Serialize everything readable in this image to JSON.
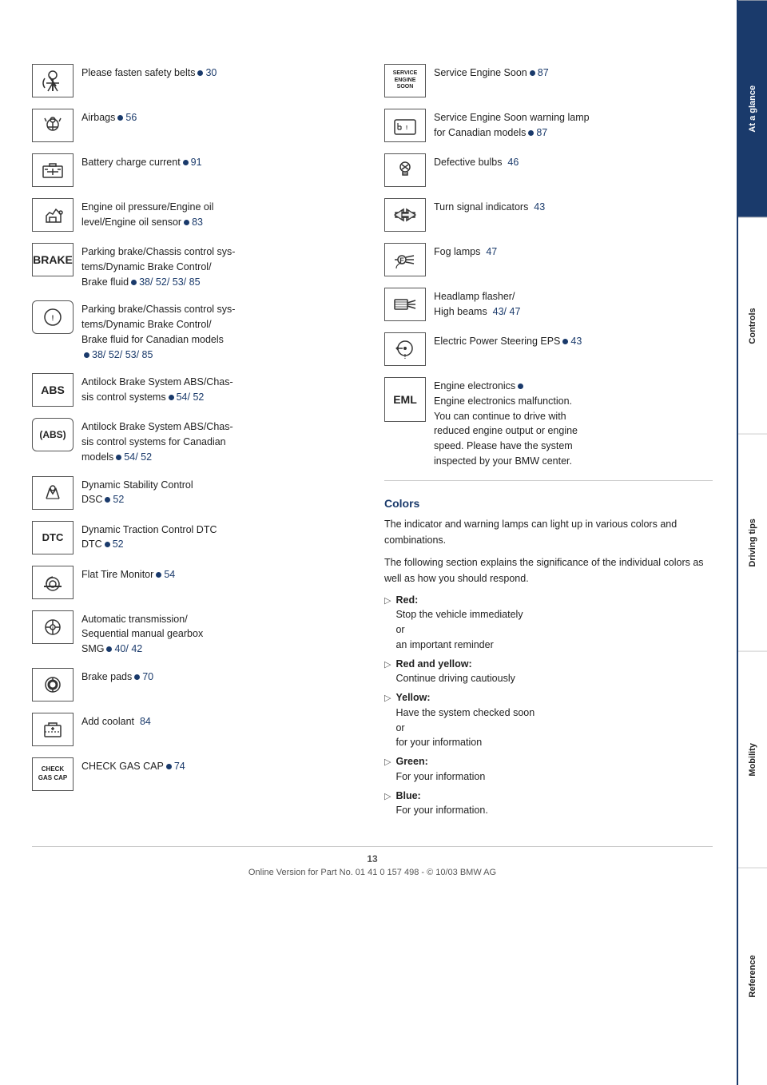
{
  "page": {
    "number": "13",
    "footer": "Online Version for Part No. 01 41 0 157 498 - © 10/03 BMW AG"
  },
  "sidebar": {
    "tabs": [
      {
        "label": "At a glance",
        "active": true
      },
      {
        "label": "Controls",
        "active": false
      },
      {
        "label": "Driving tips",
        "active": false
      },
      {
        "label": "Mobility",
        "active": false
      },
      {
        "label": "Reference",
        "active": false
      }
    ]
  },
  "left_indicators": [
    {
      "id": "seatbelt",
      "icon_type": "svg_seatbelt",
      "text": "Please fasten safety belts",
      "dot": true,
      "dot_color": "blue",
      "page": "30"
    },
    {
      "id": "airbags",
      "icon_type": "svg_airbag",
      "text": "Airbags",
      "dot": true,
      "dot_color": "blue",
      "page": "56"
    },
    {
      "id": "battery",
      "icon_type": "svg_battery",
      "text": "Battery charge current",
      "dot": true,
      "dot_color": "blue",
      "page": "91"
    },
    {
      "id": "engine_oil",
      "icon_type": "svg_oil",
      "text": "Engine oil pressure/Engine oil level/Engine oil sensor",
      "dot": true,
      "dot_color": "blue",
      "page": "83"
    },
    {
      "id": "brake_chassis",
      "icon_type": "text_BRAKE",
      "text": "Parking brake/Chassis control systems/Dynamic Brake Control/Brake fluid",
      "dot": true,
      "dot_color": "blue",
      "pages": "38/ 52/ 53/ 85"
    },
    {
      "id": "brake_chassis_canada",
      "icon_type": "svg_brake_round",
      "text": "Parking brake/Chassis control systems/Dynamic Brake Control/Brake fluid for Canadian models",
      "dot": true,
      "dot_color": "blue",
      "pages": "38/ 52/ 53/ 85"
    },
    {
      "id": "abs",
      "icon_type": "text_ABS",
      "text": "Antilock Brake System ABS/Chassis control systems",
      "dot": true,
      "dot_color": "blue",
      "pages": "54/ 52"
    },
    {
      "id": "abs_canada",
      "icon_type": "text_ABS_round",
      "text": "Antilock Brake System ABS/Chassis control systems for Canadian models",
      "dot": true,
      "dot_color": "blue",
      "pages": "54/ 52"
    },
    {
      "id": "dsc",
      "icon_type": "svg_dsc",
      "text": "Dynamic Stability Control DSC",
      "dot": true,
      "dot_color": "blue",
      "page": "52"
    },
    {
      "id": "dtc",
      "icon_type": "text_DTC",
      "text": "Dynamic Traction Control DTC",
      "dot": true,
      "dot_color": "blue",
      "page": "52"
    },
    {
      "id": "flat_tire",
      "icon_type": "svg_flat_tire",
      "text": "Flat Tire Monitor",
      "dot": true,
      "dot_color": "blue",
      "page": "54"
    },
    {
      "id": "transmission",
      "icon_type": "svg_transmission",
      "text": "Automatic transmission/Sequential manual gearbox SMG",
      "dot": true,
      "dot_color": "blue",
      "pages": "40/ 42"
    },
    {
      "id": "brake_pads",
      "icon_type": "svg_brake_pads",
      "text": "Brake pads",
      "dot": true,
      "dot_color": "blue",
      "page": "70"
    },
    {
      "id": "coolant",
      "icon_type": "svg_coolant",
      "text": "Add coolant",
      "dot": false,
      "page": "84"
    },
    {
      "id": "gas_cap",
      "icon_type": "text_CHECK_GAS_CAP",
      "text": "CHECK GAS CAP",
      "dot": true,
      "dot_color": "blue",
      "page": "74"
    }
  ],
  "right_indicators": [
    {
      "id": "service_engine",
      "icon_type": "text_SERVICE_ENGINE_SOON",
      "text": "Service Engine Soon",
      "dot": true,
      "dot_color": "blue",
      "page": "87"
    },
    {
      "id": "service_engine_canada",
      "icon_type": "svg_service_engine_canada",
      "text": "Service Engine Soon warning lamp for Canadian models",
      "dot": true,
      "dot_color": "blue",
      "page": "87"
    },
    {
      "id": "defective_bulbs",
      "icon_type": "svg_bulb",
      "text": "Defective bulbs",
      "dot": false,
      "page": "46"
    },
    {
      "id": "turn_signal",
      "icon_type": "svg_turn_signal",
      "text": "Turn signal indicators",
      "dot": false,
      "page": "43"
    },
    {
      "id": "fog_lamps",
      "icon_type": "svg_fog",
      "text": "Fog lamps",
      "dot": false,
      "page": "47"
    },
    {
      "id": "headlamp",
      "icon_type": "svg_headlamp",
      "text": "Headlamp flasher/High beams",
      "dot": false,
      "pages": "43/ 47"
    },
    {
      "id": "eps",
      "icon_type": "svg_eps",
      "text": "Electric Power Steering EPS",
      "dot": true,
      "dot_color": "blue",
      "page": "43"
    },
    {
      "id": "eml",
      "icon_type": "text_EML",
      "text": "Engine electronics\nEngine electronics malfunction. You can continue to drive with reduced engine output or engine speed. Please have the system inspected by your BMW center.",
      "dot": true,
      "dot_color": "blue"
    }
  ],
  "colors_section": {
    "title": "Colors",
    "intro1": "The indicator and warning lamps can light up in various colors and combinations.",
    "intro2": "The following section explains the significance of the individual colors as well as how you should respond.",
    "items": [
      {
        "color": "Red:",
        "lines": [
          "Stop the vehicle immediately",
          "or",
          "an important reminder"
        ]
      },
      {
        "color": "Red and yellow:",
        "lines": [
          "Continue driving cautiously"
        ]
      },
      {
        "color": "Yellow:",
        "lines": [
          "Have the system checked soon",
          "or",
          "for your information"
        ]
      },
      {
        "color": "Green:",
        "lines": [
          "For your information"
        ]
      },
      {
        "color": "Blue:",
        "lines": [
          "For your information."
        ]
      }
    ]
  }
}
